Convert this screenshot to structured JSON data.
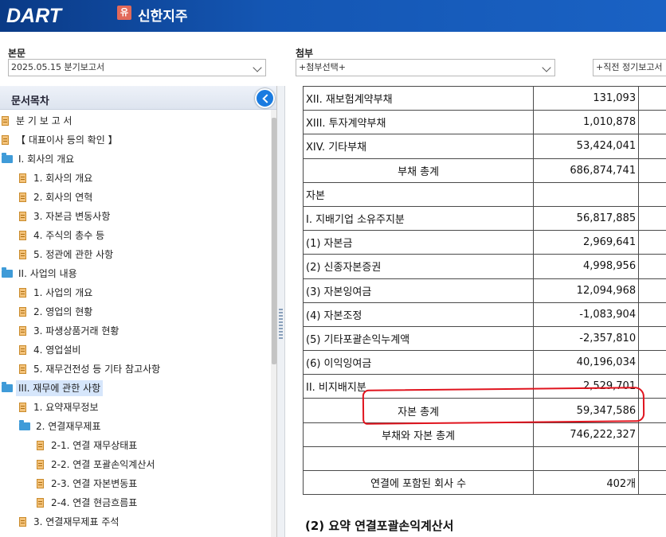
{
  "header": {
    "logo": "DART",
    "badge": "유",
    "company": "신한지주"
  },
  "selectors": {
    "main_label": "본문",
    "main_value": "2025.05.15  분기보고서",
    "attach_label": "첨부",
    "attach_value": "+첨부선택+",
    "prev_value": "+직전 정기보고서"
  },
  "toc": {
    "title": "문서목차",
    "items": [
      {
        "label": "분 기 보 고 서",
        "icon": "doc-icon"
      },
      {
        "label": "【 대표이사 등의 확인 】",
        "icon": "doc-icon"
      },
      {
        "label": "I. 회사의 개요",
        "icon": "folder-icon"
      },
      {
        "label": "1. 회사의 개요",
        "icon": "doc-icon"
      },
      {
        "label": "2. 회사의 연혁",
        "icon": "doc-icon"
      },
      {
        "label": "3. 자본금 변동사항",
        "icon": "doc-icon"
      },
      {
        "label": "4. 주식의 총수 등",
        "icon": "doc-icon"
      },
      {
        "label": "5. 정관에 관한 사항",
        "icon": "doc-icon"
      },
      {
        "label": "II. 사업의 내용",
        "icon": "folder-icon"
      },
      {
        "label": "1. 사업의 개요",
        "icon": "doc-icon"
      },
      {
        "label": "2. 영업의 현황",
        "icon": "doc-icon"
      },
      {
        "label": "3. 파생상품거래 현황",
        "icon": "doc-icon"
      },
      {
        "label": "4. 영업설비",
        "icon": "doc-icon"
      },
      {
        "label": "5. 재무건전성 등 기타 참고사항",
        "icon": "doc-icon"
      },
      {
        "label": "III. 재무에 관한 사항",
        "icon": "folder-icon",
        "selected": true
      },
      {
        "label": "1. 요약재무정보",
        "icon": "doc-icon"
      },
      {
        "label": "2. 연결재무제표",
        "icon": "folder-icon"
      },
      {
        "label": "2-1. 연결 재무상태표",
        "icon": "doc-icon"
      },
      {
        "label": "2-2. 연결 포괄손익계산서",
        "icon": "doc-icon"
      },
      {
        "label": "2-3. 연결 자본변동표",
        "icon": "doc-icon"
      },
      {
        "label": "2-4. 연결 현금흐름표",
        "icon": "doc-icon"
      },
      {
        "label": "3. 연결재무제표 주석",
        "icon": "doc-icon"
      }
    ]
  },
  "table": {
    "rows": [
      {
        "label": "XII. 재보험계약부채",
        "value": "131,093"
      },
      {
        "label": "XIII. 투자계약부채",
        "value": "1,010,878"
      },
      {
        "label": "XIV. 기타부채",
        "value": "53,424,041"
      },
      {
        "label": "부채 총계",
        "value": "686,874,741",
        "center": true
      },
      {
        "label": "자본",
        "value": ""
      },
      {
        "label": "Ⅰ. 지배기업 소유주지분",
        "value": "56,817,885"
      },
      {
        "label": "(1) 자본금",
        "value": "2,969,641"
      },
      {
        "label": "(2) 신종자본증권",
        "value": "4,998,956"
      },
      {
        "label": "(3) 자본잉여금",
        "value": "12,094,968"
      },
      {
        "label": "(4) 자본조정",
        "value": "-1,083,904"
      },
      {
        "label": "(5) 기타포괄손익누계액",
        "value": "-2,357,810"
      },
      {
        "label": "(6) 이익잉여금",
        "value": "40,196,034"
      },
      {
        "label": "II. 비지배지분",
        "value": "2,529,701"
      },
      {
        "label": "자본 총계",
        "value": "59,347,586",
        "center": true
      },
      {
        "label": "부채와 자본 총계",
        "value": "746,222,327",
        "center": true
      },
      {
        "label": "",
        "value": ""
      },
      {
        "label": "연결에 포함된 회사 수",
        "value": "402개",
        "center": true
      }
    ]
  },
  "next_heading": "(2) 요약 연결포괄손익계산서"
}
